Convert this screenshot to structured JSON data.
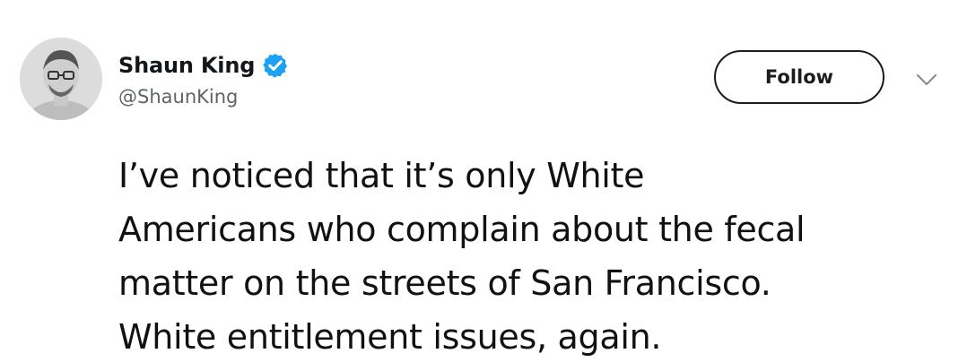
{
  "tweet": {
    "author": {
      "display_name": "Shaun King",
      "handle": "@ShaunKing",
      "verified": true,
      "verified_icon": "verified-badge-icon"
    },
    "follow_label": "Follow",
    "menu_icon": "chevron-down-icon",
    "text_lines": [
      "I’ve noticed that it’s only White",
      "Americans who complain about the fecal",
      "matter on the streets of San Francisco.",
      "White entitlement issues, again."
    ]
  },
  "colors": {
    "verified_blue": "#1da1f2",
    "text": "#14171a",
    "handle_gray": "#5f6368"
  }
}
